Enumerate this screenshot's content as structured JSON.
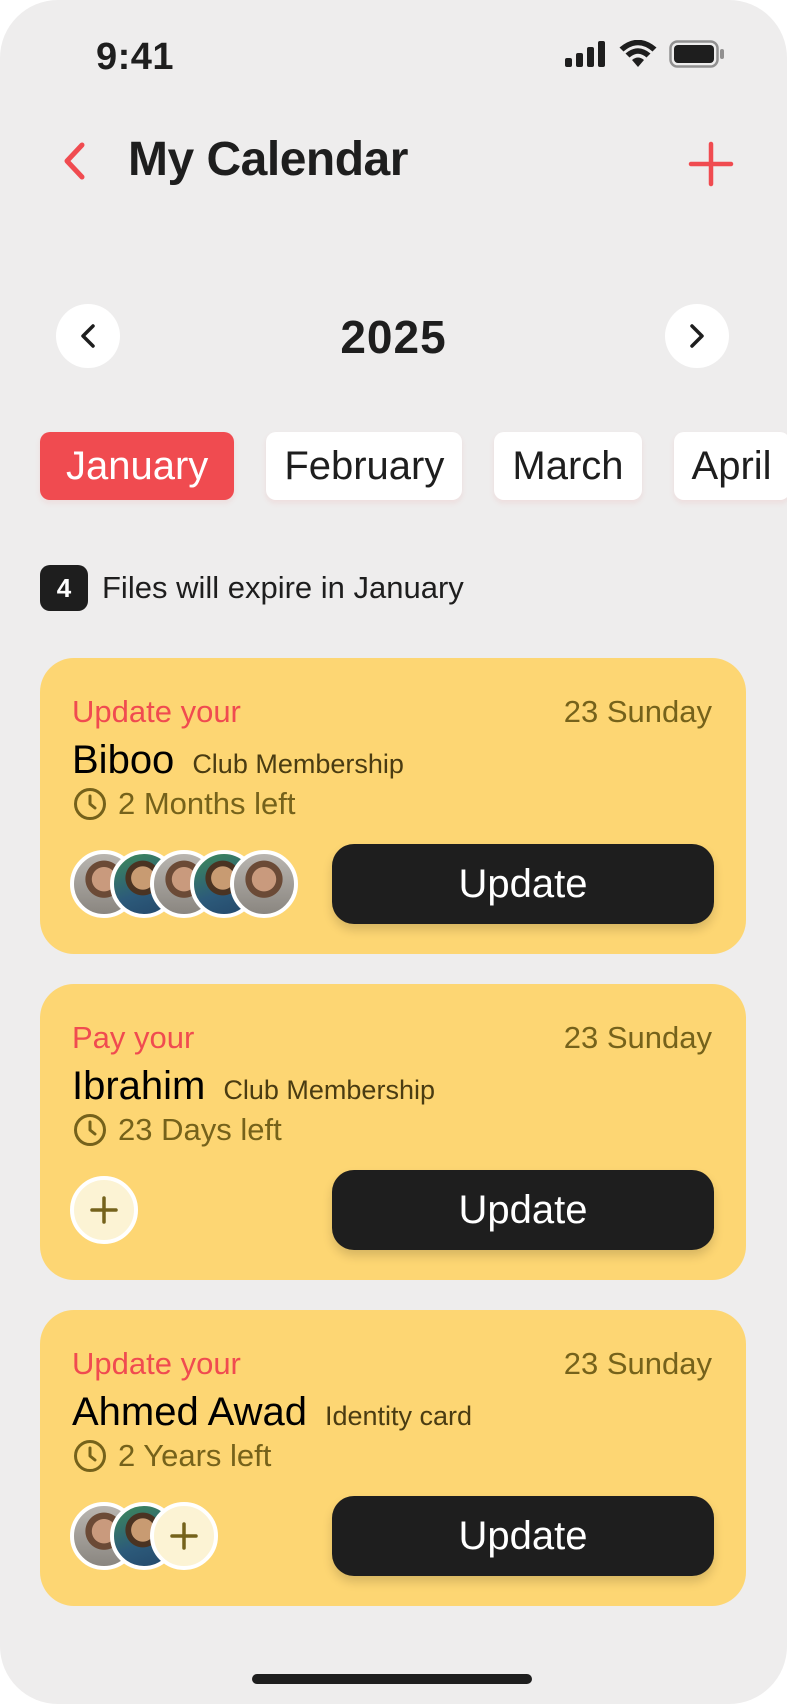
{
  "status_bar": {
    "time": "9:41"
  },
  "header": {
    "title": "My Calendar",
    "back_icon": "chevron-left-icon",
    "add_icon": "plus-icon",
    "accent_color": "#f04b50"
  },
  "year_selector": {
    "year": "2025"
  },
  "months": [
    {
      "label": "January",
      "selected": true
    },
    {
      "label": "February",
      "selected": false
    },
    {
      "label": "March",
      "selected": false
    },
    {
      "label": "April",
      "selected": false
    }
  ],
  "notice": {
    "count": "4",
    "text": "Files will expire in January"
  },
  "cards": [
    {
      "action": "Update your",
      "date": "23 Sunday",
      "name": "Biboo",
      "type": "Club Membership",
      "time_left": "2 Months left",
      "button": "Update"
    },
    {
      "action": "Pay your",
      "date": "23 Sunday",
      "name": "Ibrahim",
      "type": "Club Membership",
      "time_left": "23 Days left",
      "button": "Update"
    },
    {
      "action": "Update your",
      "date": "23 Sunday",
      "name": "Ahmed Awad",
      "type": "Identity card",
      "time_left": "2 Years left",
      "button": "Update"
    }
  ],
  "colors": {
    "card_bg": "#fdd673",
    "accent": "#f04b50",
    "dark": "#1e1e1e",
    "muted_gold": "#75621b"
  }
}
